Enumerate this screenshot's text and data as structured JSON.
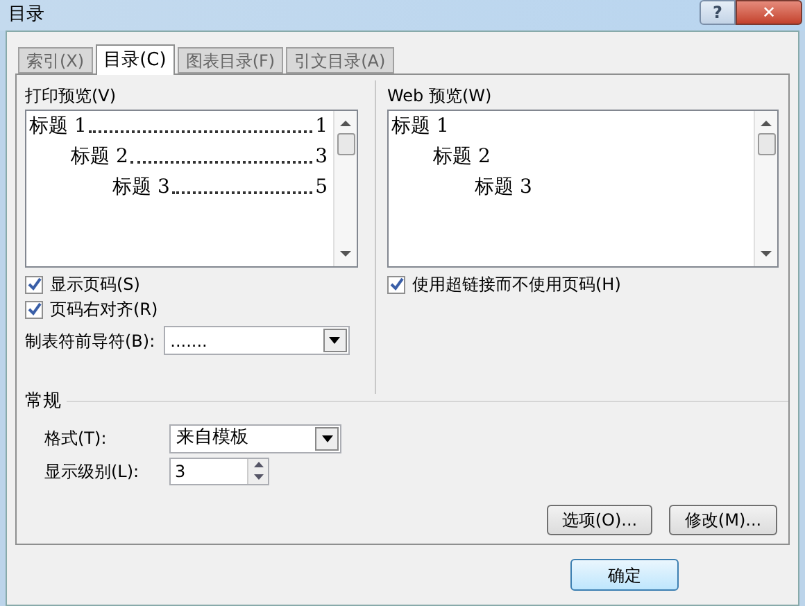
{
  "window": {
    "title": "目录",
    "help": "?",
    "close": "✕"
  },
  "tabs": [
    {
      "label": "索引(X)",
      "selected": false
    },
    {
      "label": "目录(C)",
      "selected": true
    },
    {
      "label": "图表目录(F)",
      "selected": false
    },
    {
      "label": "引文目录(A)",
      "selected": false
    }
  ],
  "print_preview": {
    "label": "打印预览(V)",
    "entries": [
      {
        "text": "标题 1",
        "page": "1",
        "children": [
          {
            "text": "标题 2",
            "page": "3",
            "children": [
              {
                "text": "标题 3",
                "page": "5"
              }
            ]
          }
        ]
      }
    ]
  },
  "web_preview": {
    "label": "Web 预览(W)",
    "entries": [
      {
        "text": "标题 1",
        "children": [
          {
            "text": "标题 2",
            "children": [
              {
                "text": "标题 3"
              }
            ]
          }
        ]
      }
    ]
  },
  "print_options": [
    {
      "label": "显示页码(S)",
      "checked": true
    },
    {
      "label": "页码右对齐(R)",
      "checked": true
    }
  ],
  "tab_leader": {
    "label": "制表符前导符(B):",
    "value": "......."
  },
  "web_options": [
    {
      "label": "使用超链接而不使用页码(H)",
      "checked": true
    }
  ],
  "general": {
    "title": "常规",
    "format": {
      "label": "格式(T):",
      "value": "来自模板"
    },
    "levels": {
      "label": "显示级别(L):",
      "value": "3"
    }
  },
  "buttons": {
    "options": "选项(O)...",
    "modify": "修改(M)...",
    "ok": "确定"
  }
}
